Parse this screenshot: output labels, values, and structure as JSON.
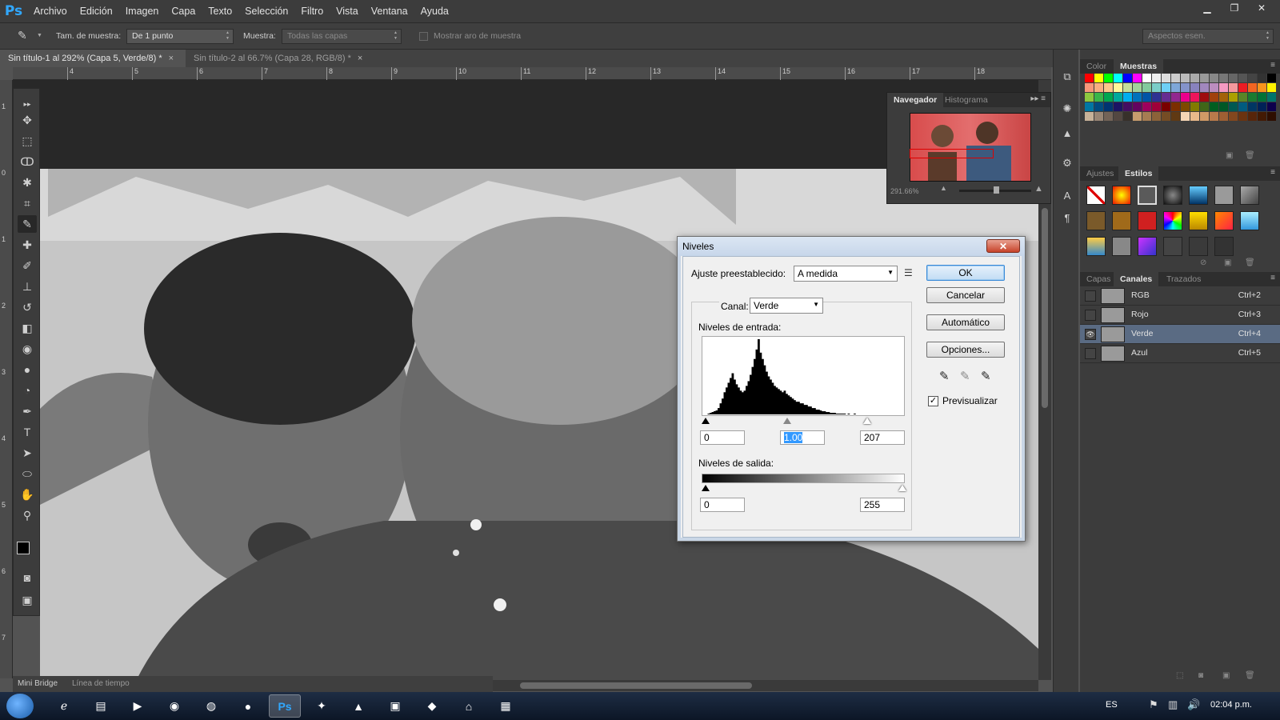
{
  "app": {
    "logo": "Ps",
    "menu": [
      "Archivo",
      "Edición",
      "Imagen",
      "Capa",
      "Texto",
      "Selección",
      "Filtro",
      "Vista",
      "Ventana",
      "Ayuda"
    ],
    "window_controls": [
      "minimize",
      "restore",
      "close"
    ]
  },
  "options_bar": {
    "sample_size_label": "Tam. de muestra:",
    "sample_size_value": "De 1 punto",
    "sample_label": "Muestra:",
    "sample_value": "Todas las capas",
    "show_ring_label": "Mostrar aro de muestra",
    "workspace": "Aspectos esen."
  },
  "doc_tabs": [
    {
      "label": "Sin título-1 al 292% (Capa 5, Verde/8) *",
      "close": "×"
    },
    {
      "label": "Sin título-2 al 66.7% (Capa 28, RGB/8) *",
      "close": "×"
    }
  ],
  "ruler": {
    "h_ticks": [
      "4",
      "5",
      "6",
      "7",
      "8",
      "9",
      "10",
      "11",
      "12",
      "13",
      "14",
      "15",
      "16",
      "17",
      "18"
    ],
    "v_ticks": [
      "1",
      "0",
      "1",
      "2",
      "3",
      "4",
      "5",
      "6",
      "7"
    ]
  },
  "bottom_panel": {
    "tabs": [
      "Mini Bridge",
      "Línea de tiempo"
    ]
  },
  "navigator": {
    "tabs": [
      "Navegador",
      "Histograma"
    ],
    "zoom": "291.66%"
  },
  "dock": {
    "color_tabs": [
      "Color",
      "Muestras"
    ],
    "adjust_tabs": [
      "Ajustes",
      "Estilos"
    ],
    "layer_tabs": [
      "Capas",
      "Canales",
      "Trazados"
    ],
    "channels": [
      {
        "name": "RGB",
        "shortcut": "Ctrl+2",
        "visible": false
      },
      {
        "name": "Rojo",
        "shortcut": "Ctrl+3",
        "visible": false
      },
      {
        "name": "Verde",
        "shortcut": "Ctrl+4",
        "visible": true
      },
      {
        "name": "Azul",
        "shortcut": "Ctrl+5",
        "visible": false
      }
    ],
    "swatch_colors": [
      "#ff0000",
      "#ffff00",
      "#00ff00",
      "#00ffff",
      "#0000ff",
      "#ff00ff",
      "#ffffff",
      "#eeeeee",
      "#dddddd",
      "#cccccc",
      "#bbbbbb",
      "#aaaaaa",
      "#999999",
      "#888888",
      "#777777",
      "#666666",
      "#555555",
      "#444444",
      "#333333",
      "#000000",
      "#f7977a",
      "#f9ad81",
      "#fdc68a",
      "#fff79a",
      "#c4df9b",
      "#a2d39c",
      "#82ca9d",
      "#7bcdc8",
      "#6ecff6",
      "#7ea7d8",
      "#8493ca",
      "#8882be",
      "#a187be",
      "#bc8dbf",
      "#f49ac2",
      "#f6989d",
      "#ed1c24",
      "#f26522",
      "#f7941d",
      "#fff200",
      "#8dc73f",
      "#39b54a",
      "#00a651",
      "#00a99d",
      "#00aeef",
      "#0072bc",
      "#0054a6",
      "#2e3192",
      "#662d91",
      "#92278f",
      "#ec008c",
      "#ed145b",
      "#9e0b0f",
      "#a0410d",
      "#a36209",
      "#aba000",
      "#598527",
      "#1a7b30",
      "#007236",
      "#00746b",
      "#0076a3",
      "#004b80",
      "#003471",
      "#1b1464",
      "#440e62",
      "#630460",
      "#9e005d",
      "#9e0039",
      "#790000",
      "#7b2e00",
      "#7d4900",
      "#827b00",
      "#406618",
      "#005e20",
      "#005826",
      "#005952",
      "#005b7f",
      "#003663",
      "#002157",
      "#0d004c",
      "#c7b299",
      "#998675",
      "#736357",
      "#534741",
      "#37302a",
      "#c69c6d",
      "#a67c52",
      "#8c6239",
      "#754c24",
      "#603913",
      "#f5d5b5",
      "#e8b98a",
      "#d19a66",
      "#b97a4b",
      "#9e5f33",
      "#83471e",
      "#6b3310",
      "#57250a",
      "#431a04",
      "#2e0e00"
    ]
  },
  "levels_dialog": {
    "title": "Niveles",
    "preset_label": "Ajuste preestablecido:",
    "preset_value": "A medida",
    "channel_label": "Canal:",
    "channel_value": "Verde",
    "input_levels_label": "Niveles de entrada:",
    "input_black": "0",
    "input_gamma": "1.00",
    "input_white": "207",
    "output_levels_label": "Niveles de salida:",
    "output_black": "0",
    "output_white": "255",
    "buttons": {
      "ok": "OK",
      "cancel": "Cancelar",
      "auto": "Automático",
      "options": "Opciones..."
    },
    "preview_label": "Previsualizar",
    "preview_checked": true,
    "histogram": [
      0,
      1,
      2,
      3,
      4,
      5,
      8,
      14,
      20,
      28,
      34,
      40,
      46,
      52,
      44,
      38,
      34,
      30,
      28,
      30,
      36,
      42,
      50,
      60,
      70,
      82,
      95,
      78,
      70,
      62,
      54,
      48,
      44,
      40,
      36,
      34,
      32,
      30,
      28,
      30,
      26,
      24,
      22,
      20,
      18,
      16,
      16,
      14,
      14,
      12,
      12,
      10,
      10,
      8,
      8,
      6,
      6,
      5,
      4,
      4,
      3,
      3,
      2,
      2,
      2,
      1,
      1,
      1,
      1,
      1,
      0,
      1,
      0,
      0,
      1,
      0,
      0,
      0,
      0,
      0
    ]
  },
  "taskbar": {
    "lang": "ES",
    "clock": "02:04 p.m."
  }
}
